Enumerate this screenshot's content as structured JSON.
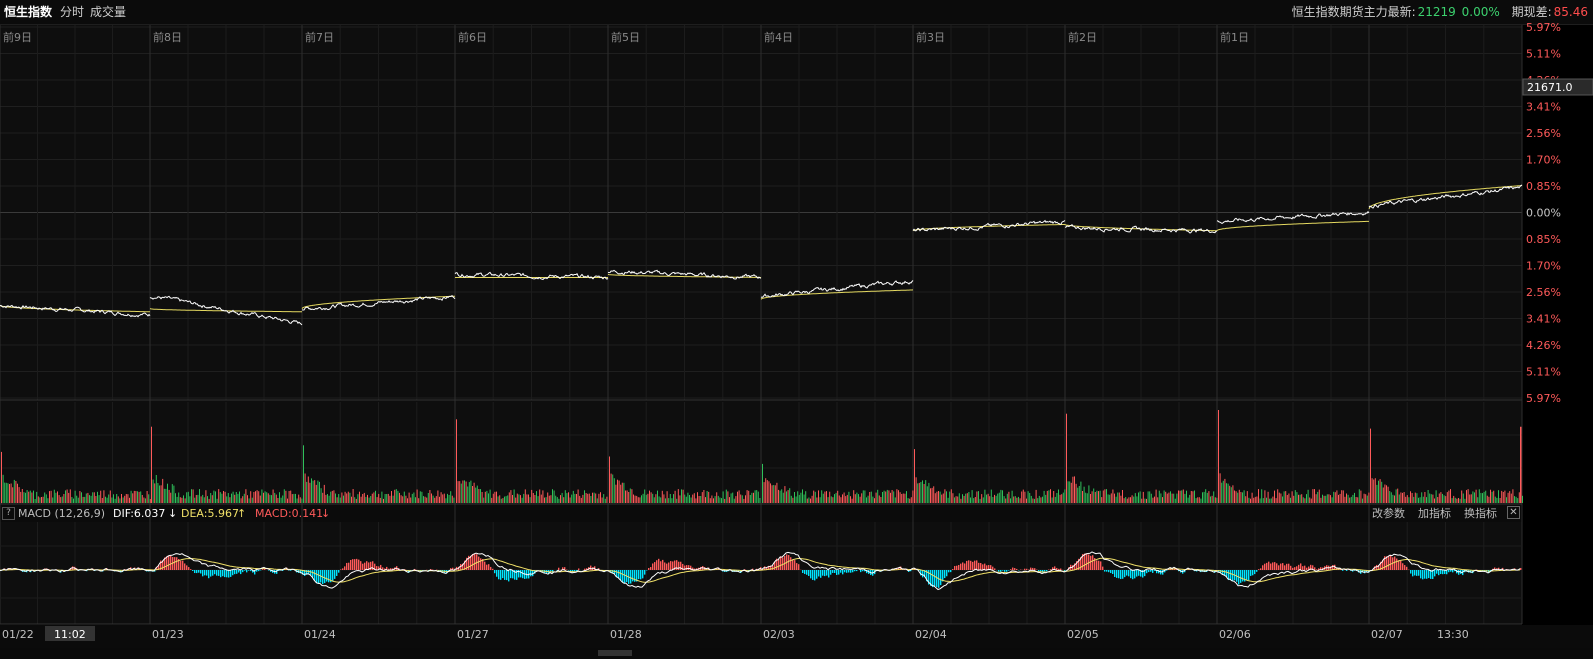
{
  "header": {
    "title": "恒生指数",
    "tabs": [
      "分时",
      "成交量"
    ],
    "future_label": "恒生指数期货主力最新:",
    "future_price": "21219",
    "future_change": "0.00%",
    "basis_label": "期现差:",
    "basis_value": "85.46"
  },
  "chart_data": [
    {
      "type": "line",
      "panel": "intraday-price",
      "day_labels": [
        "前9日",
        "前8日",
        "前7日",
        "前6日",
        "前5日",
        "前4日",
        "前3日",
        "前2日",
        "前1日"
      ],
      "y_tick_labels": [
        "5.97%",
        "5.11%",
        "4.26%",
        "3.41%",
        "2.56%",
        "1.70%",
        "0.85%",
        "0.00%",
        "0.85%",
        "1.70%",
        "2.56%",
        "3.41%",
        "4.26%",
        "5.11%",
        "5.97%"
      ],
      "price_tag": "21671.0",
      "sessions": [
        {
          "x": "01/22",
          "price_start": -3.0,
          "price_end": -3.3,
          "avg_start": -3.0,
          "avg_end": -3.2
        },
        {
          "x": "01/23",
          "price_start": -2.7,
          "price_end": -3.6,
          "avg_start": -3.1,
          "avg_end": -3.2
        },
        {
          "x": "01/24",
          "price_start": -3.1,
          "price_end": -2.7,
          "avg_start": -3.1,
          "avg_end": -2.7
        },
        {
          "x": "01/27",
          "price_start": -2.0,
          "price_end": -2.1,
          "avg_start": -2.1,
          "avg_end": -2.1
        },
        {
          "x": "01/28",
          "price_start": -1.9,
          "price_end": -2.1,
          "avg_start": -2.0,
          "avg_end": -2.1
        },
        {
          "x": "02/03",
          "price_start": -2.7,
          "price_end": -2.2,
          "avg_start": -2.8,
          "avg_end": -2.5
        },
        {
          "x": "02/04",
          "price_start": -0.6,
          "price_end": -0.3,
          "avg_start": -0.6,
          "avg_end": -0.4
        },
        {
          "x": "02/05",
          "price_start": -0.5,
          "price_end": -0.6,
          "avg_start": -0.4,
          "avg_end": -0.6
        },
        {
          "x": "02/06",
          "price_start": -0.3,
          "price_end": 0.0,
          "avg_start": -0.6,
          "avg_end": -0.3
        },
        {
          "x": "02/07",
          "price_start": 0.2,
          "price_end": 0.8,
          "avg_start": 0.1,
          "avg_end": 0.85
        }
      ],
      "series": [
        {
          "name": "price",
          "color": "#ffffff"
        },
        {
          "name": "average",
          "color": "#e3d860"
        }
      ]
    },
    {
      "type": "bar",
      "panel": "volume",
      "colors": {
        "up": "#ff5a5a",
        "down": "#2fc05a"
      },
      "session_open_spikes": [
        0.55,
        0.82,
        0.62,
        0.9,
        0.5,
        0.42,
        0.58,
        0.96,
        1.0,
        0.8,
        0.95
      ],
      "spike_up": [
        true,
        true,
        false,
        true,
        true,
        false,
        true,
        true,
        true,
        true,
        true
      ]
    },
    {
      "type": "line",
      "panel": "macd",
      "legend": {
        "name": "MACD (12,26,9)",
        "dif": "DIF:6.037",
        "dea": "DEA:5.967",
        "macd": "MACD:0.141"
      },
      "series": [
        {
          "name": "DIF",
          "color": "#ffffff"
        },
        {
          "name": "DEA",
          "color": "#f0e068"
        }
      ],
      "histogram_colors": {
        "positive": "#ff5a5a",
        "negative": "#00e5ff"
      }
    }
  ],
  "macd_tools": {
    "params": "改参数",
    "add": "加指标",
    "switch": "换指标",
    "close": "✕",
    "help": "?"
  },
  "x_axis": {
    "labels": [
      "01/22",
      "01/23",
      "01/24",
      "01/27",
      "01/28",
      "02/03",
      "02/04",
      "02/05",
      "02/06",
      "02/07",
      "13:30"
    ],
    "cursor_time": "11:02"
  }
}
